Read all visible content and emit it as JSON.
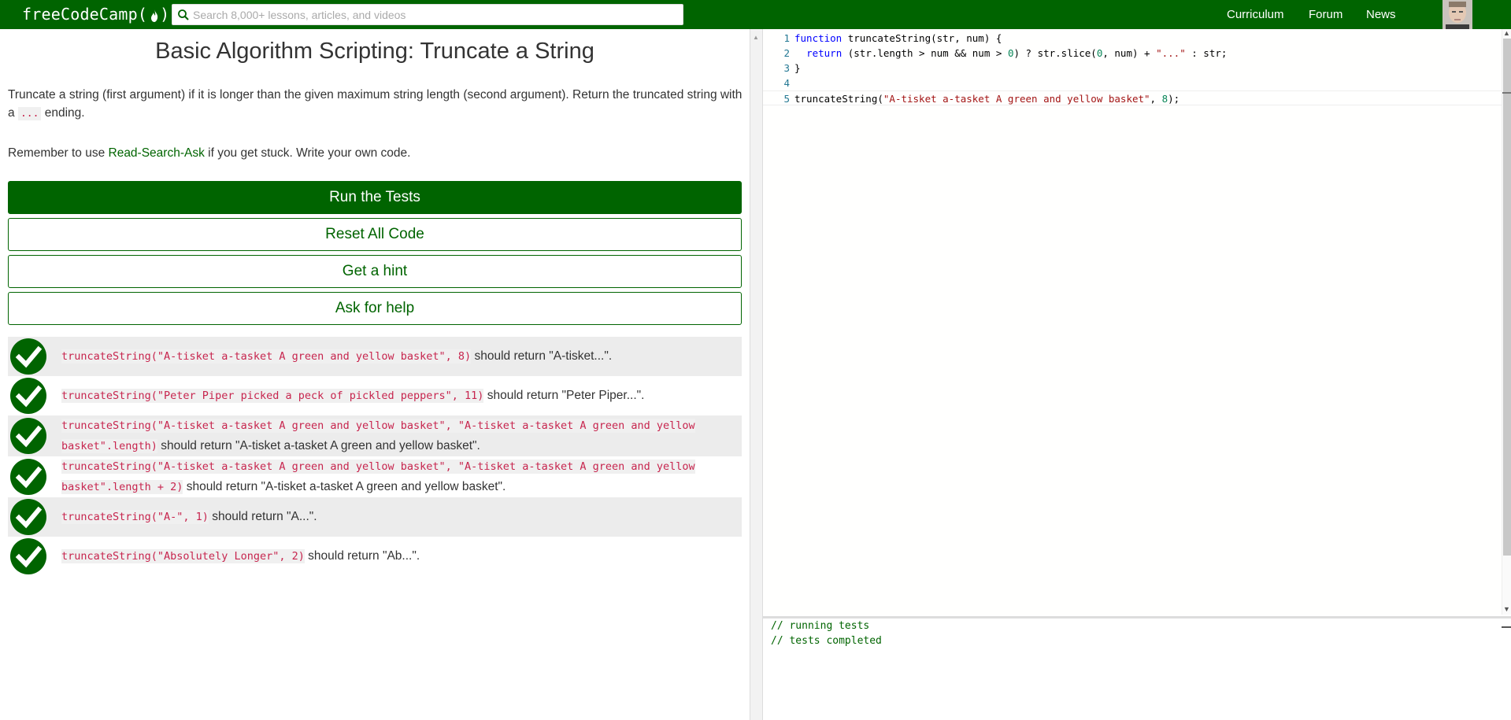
{
  "navbar": {
    "logo_text": "freeCodeCamp(",
    "logo_close": ")",
    "search_placeholder": "Search 8,000+ lessons, articles, and videos",
    "links": [
      "Curriculum",
      "Forum",
      "News"
    ]
  },
  "challenge": {
    "title": "Basic Algorithm Scripting: Truncate a String",
    "description_part1": "Truncate a string (first argument) if it is longer than the given maximum string length (second argument). Return the truncated string with a ",
    "description_code": "...",
    "description_part2": " ending.",
    "remember_prefix": "Remember to use ",
    "remember_link": "Read-Search-Ask",
    "remember_suffix": " if you get stuck. Write your own code."
  },
  "buttons": {
    "run": "Run the Tests",
    "reset": "Reset All Code",
    "hint": "Get a hint",
    "help": "Ask for help"
  },
  "tests": [
    {
      "code": "truncateString(\"A-tisket a-tasket A green and yellow basket\", 8)",
      "text": " should return \"A-tisket...\".",
      "passed": true
    },
    {
      "code": "truncateString(\"Peter Piper picked a peck of pickled peppers\", 11)",
      "text": " should return \"Peter Piper...\".",
      "passed": true
    },
    {
      "code": "truncateString(\"A-tisket a-tasket A green and yellow basket\", \"A-tisket a-tasket A green and yellow basket\".length)",
      "text": " should return \"A-tisket a-tasket A green and yellow basket\".",
      "passed": true
    },
    {
      "code": "truncateString(\"A-tisket a-tasket A green and yellow basket\", \"A-tisket a-tasket A green and yellow basket\".length + 2)",
      "text": " should return \"A-tisket a-tasket A green and yellow basket\".",
      "passed": true
    },
    {
      "code": "truncateString(\"A-\", 1)",
      "text": " should return \"A...\".",
      "passed": true
    },
    {
      "code": "truncateString(\"Absolutely Longer\", 2)",
      "text": " should return \"Ab...\".",
      "passed": true
    }
  ],
  "editor": {
    "lines": [
      {
        "n": "1",
        "code": "function truncateString(str, num) {"
      },
      {
        "n": "2",
        "code": "  return (str.length > num && num > 0) ? str.slice(0, num) + \"...\" : str;"
      },
      {
        "n": "3",
        "code": "}"
      },
      {
        "n": "4",
        "code": ""
      },
      {
        "n": "5",
        "code": "truncateString(\"A-tisket a-tasket A green and yellow basket\", 8);"
      }
    ]
  },
  "console": {
    "lines": [
      "// running tests",
      "// tests completed"
    ]
  },
  "colors": {
    "brand": "#006400",
    "code_string": "#c7254e"
  }
}
